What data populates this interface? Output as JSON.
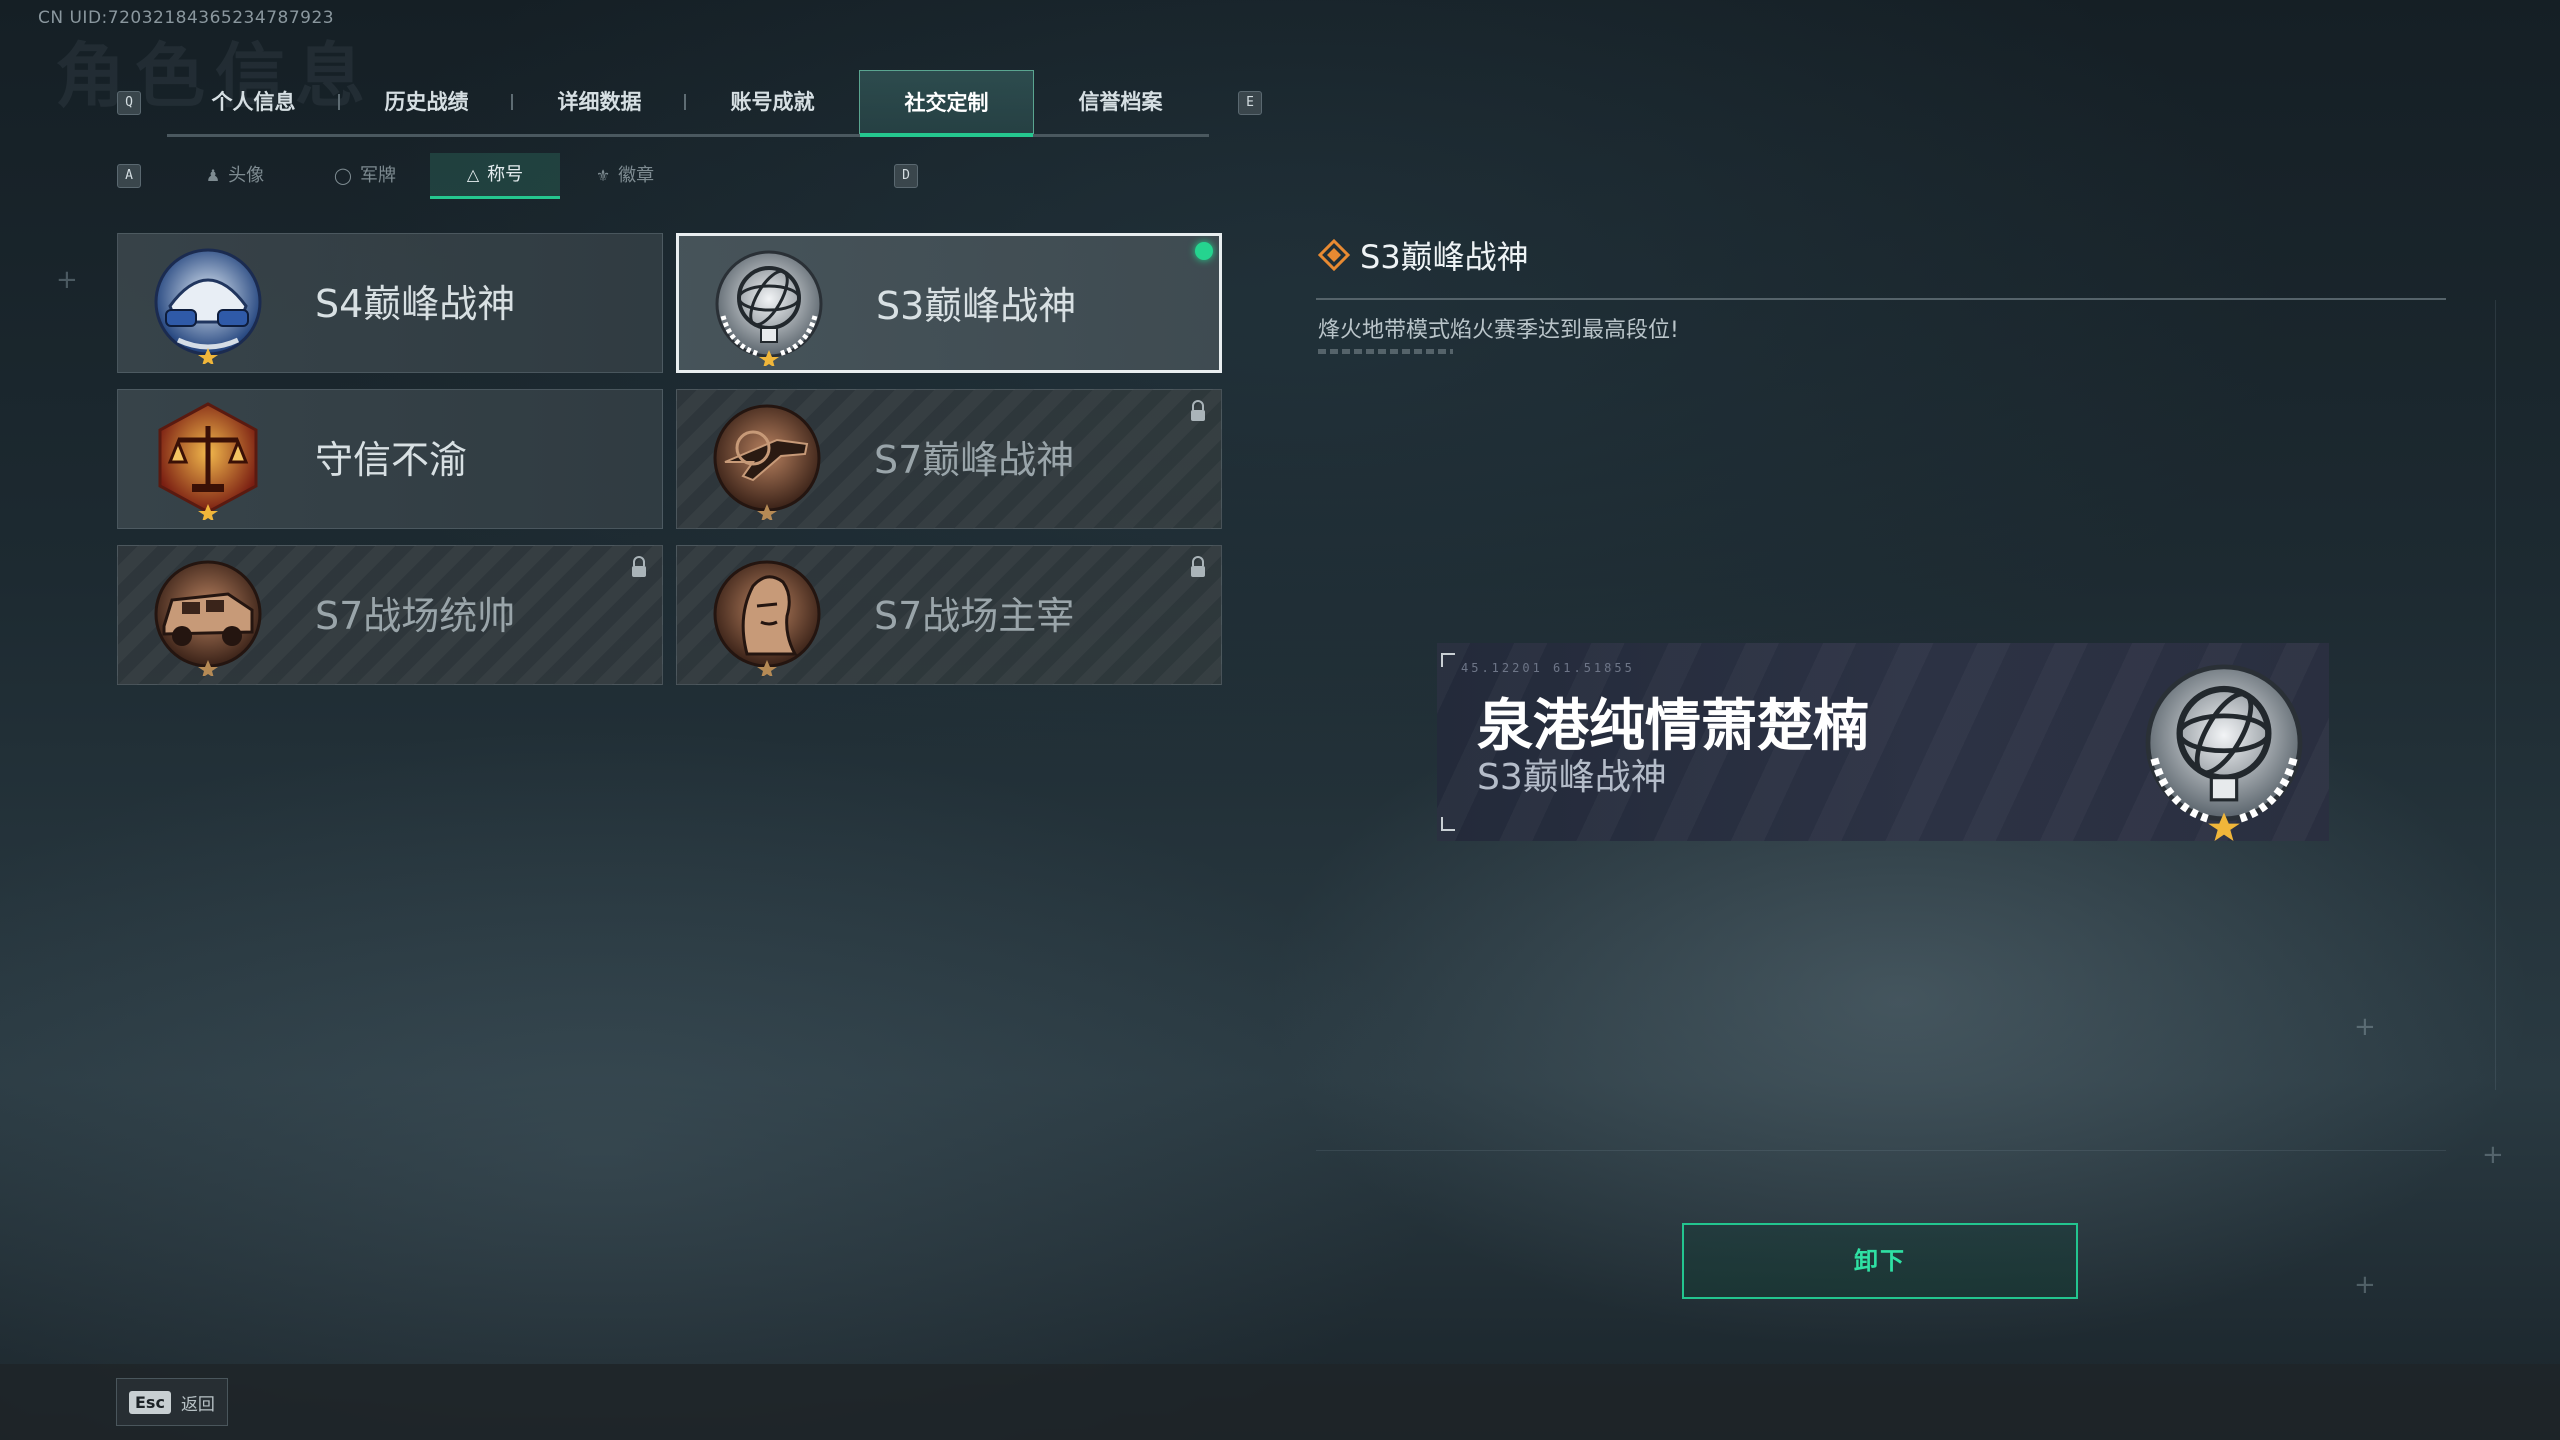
{
  "uid_text": "CN UID:720321843652347879​23",
  "header_ghost": "角色信息",
  "keys": {
    "prev_tab": "Q",
    "next_tab": "E",
    "prev_sub": "A",
    "next_sub": "D"
  },
  "tabs": [
    {
      "label": "个人信息"
    },
    {
      "label": "历史战绩"
    },
    {
      "label": "详细数据"
    },
    {
      "label": "账号成就"
    },
    {
      "label": "社交定制"
    },
    {
      "label": "信誉档案"
    }
  ],
  "subtabs": [
    {
      "label": "头像",
      "icon": "person-icon"
    },
    {
      "label": "军牌",
      "icon": "dogtag-icon"
    },
    {
      "label": "称号",
      "icon": "title-icon"
    },
    {
      "label": "徽章",
      "icon": "badge-icon"
    }
  ],
  "titles": [
    {
      "name": "S4巅峰战神",
      "locked": false,
      "selected": false,
      "emblem": "helmet-emblem"
    },
    {
      "name": "S3巅峰战神",
      "locked": false,
      "selected": true,
      "equipped": true,
      "emblem": "armillary-emblem"
    },
    {
      "name": "守信不渝",
      "locked": false,
      "selected": false,
      "emblem": "scales-emblem"
    },
    {
      "name": "S7巅峰战神",
      "locked": true,
      "selected": false,
      "emblem": "rifle-emblem"
    },
    {
      "name": "S7战场统帅",
      "locked": true,
      "selected": false,
      "emblem": "vehicle-emblem"
    },
    {
      "name": "S7战场主宰",
      "locked": true,
      "selected": false,
      "emblem": "soldier-emblem"
    }
  ],
  "detail": {
    "title": "S3巅峰战神",
    "description": "烽火地带模式焰火赛季达到最高段位!"
  },
  "preview": {
    "code": "45.12201  61.51855",
    "player_name": "泉港纯情萧楚楠",
    "title": "S3巅峰战神"
  },
  "unequip_label": "卸下",
  "back": {
    "key": "Esc",
    "label": "返回"
  },
  "colors": {
    "accent": "#25c78f",
    "selected_border": "#e9eef0"
  }
}
